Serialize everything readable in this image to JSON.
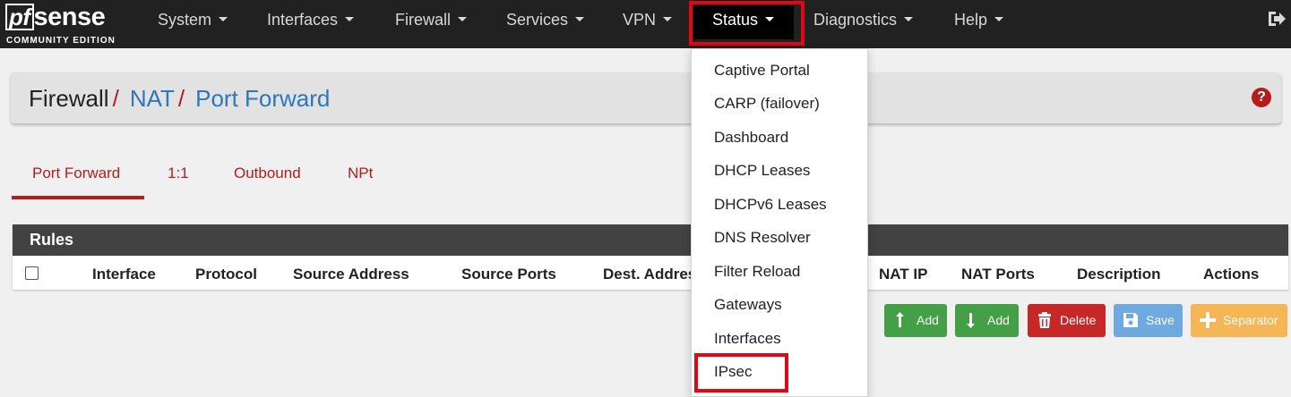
{
  "brand": {
    "name_pf": "pf",
    "name_rest": "sense",
    "edition": "COMMUNITY EDITION"
  },
  "nav": {
    "items": [
      "System",
      "Interfaces",
      "Firewall",
      "Services",
      "VPN",
      "Status",
      "Diagnostics",
      "Help"
    ],
    "active": "Status"
  },
  "breadcrumb": {
    "first": "Firewall",
    "sep": "/",
    "second": "NAT",
    "third": "Port Forward"
  },
  "help_label": "?",
  "tabs": [
    "Port Forward",
    "1:1",
    "Outbound",
    "NPt"
  ],
  "rules": {
    "title": "Rules",
    "columns": [
      "Interface",
      "Protocol",
      "Source Address",
      "Source Ports",
      "Dest. Address",
      "NAT IP",
      "NAT Ports",
      "Description",
      "Actions"
    ]
  },
  "buttons": {
    "add_up": "Add",
    "add_down": "Add",
    "delete": "Delete",
    "save": "Save",
    "separator": "Separator"
  },
  "status_menu": [
    "Captive Portal",
    "CARP (failover)",
    "Dashboard",
    "DHCP Leases",
    "DHCPv6 Leases",
    "DNS Resolver",
    "Filter Reload",
    "Gateways",
    "Interfaces",
    "IPsec"
  ],
  "colors": {
    "accent": "#b71c1c",
    "link": "#2d77be",
    "highlight": "#e30613",
    "navbar": "#212121"
  }
}
